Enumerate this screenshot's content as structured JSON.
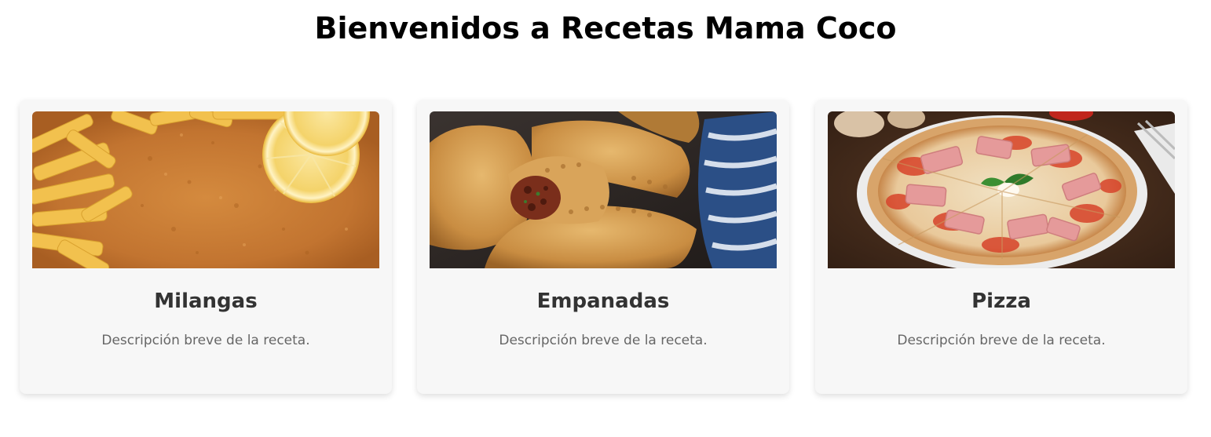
{
  "page": {
    "title": "Bienvenidos a Recetas Mama Coco"
  },
  "cards": [
    {
      "title": "Milangas",
      "description": "Descripción breve de la receta.",
      "image": "milanesa-photo"
    },
    {
      "title": "Empanadas",
      "description": "Descripción breve de la receta.",
      "image": "empanadas-photo"
    },
    {
      "title": "Pizza",
      "description": "Descripción breve de la receta.",
      "image": "pizza-photo"
    }
  ],
  "colors": {
    "title": "#000000",
    "card_background": "#f7f7f7",
    "card_title": "#333333",
    "card_description": "#666666"
  }
}
